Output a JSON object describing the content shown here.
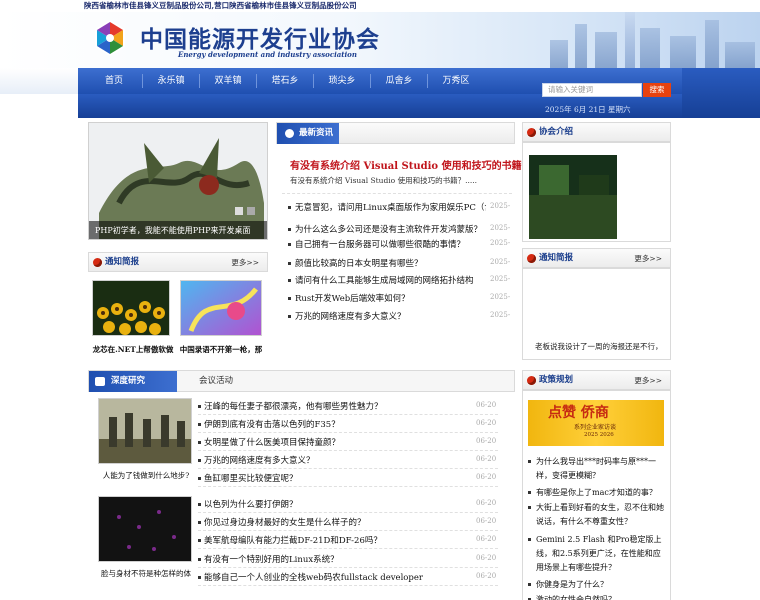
{
  "topbar": {
    "text": "陕西省榆林市佳县锋义豆制品股份公司,营口陕西省榆林市佳县锋义豆制品股份公司"
  },
  "header": {
    "title": "中国能源开发行业协会",
    "subtitle": "Energy development and industry association"
  },
  "nav": {
    "items": [
      "首页",
      "永乐镇",
      "双羊镇",
      "塔石乡",
      "琐尖乡",
      "瓜舍乡",
      "万秀区"
    ]
  },
  "search": {
    "placeholder": "请输入关键词",
    "button": "搜索"
  },
  "date": "2025年 6月 21日  星期六",
  "slide": {
    "caption": "PHP初学者，我能不能使用PHP来开发桌面"
  },
  "latest": {
    "title": "最新资讯",
    "headline": "有没有系统介绍 Visual Studio 使用和技巧的书籍？",
    "summary": "有没有系统介绍 Visual Studio 使用和技巧的书籍？.....",
    "items": [
      {
        "text": "无意冒犯，请问用Linux桌面版作为家用娱乐PC（含",
        "date": "2025-"
      },
      {
        "text": "为什么这么多公司还是没有主流软件开发鸿蒙版？",
        "date": "2025-"
      },
      {
        "text": "自己拥有一台服务器可以做哪些很酷的事情？",
        "date": "2025-"
      },
      {
        "text": "颜值比较高的日本女明星有哪些？",
        "date": "2025-"
      },
      {
        "text": "请问有什么工具能够生成局域网的网络拓扑结构",
        "date": "2025-"
      },
      {
        "text": "Rust开发Web后端效率如何？",
        "date": "2025-"
      },
      {
        "text": "万兆的网络速度有多大意义？",
        "date": "2025-"
      }
    ]
  },
  "notice": {
    "title": "通知简报",
    "more": "更多>>",
    "items": [
      {
        "caption": "龙芯在.NET上帮傲软做"
      },
      {
        "caption": "中国录语不开第一枪，那"
      }
    ]
  },
  "association": {
    "title": "协会介绍"
  },
  "notice_right": {
    "title": "通知简报",
    "more": "更多>>",
    "caption": "老板说我设计了一周的海报还是不行，"
  },
  "research": {
    "tab_active": "深度研究",
    "tab_other": "会议活动",
    "groups": [
      {
        "caption": "人能为了钱做到什么地步?",
        "items": [
          {
            "text": "汪峰的每任妻子都很漂亮，他有哪些男性魅力？",
            "date": "06-20"
          },
          {
            "text": "伊朗到底有没有击落以色列的F35？",
            "date": "06-20"
          },
          {
            "text": "女明星做了什么医美项目保持童颜？",
            "date": "06-20"
          },
          {
            "text": "万兆的网络速度有多大意义？",
            "date": "06-20"
          },
          {
            "text": "鱼缸哪里买比较便宜呢？",
            "date": "06-20"
          }
        ]
      },
      {
        "caption": "脸与身材不符是种怎样的体",
        "items": [
          {
            "text": "以色列为什么要打伊朗？",
            "date": "06-20"
          },
          {
            "text": "你见过身边身材最好的女生是什么样子的？",
            "date": "06-20"
          },
          {
            "text": "美军航母编队有能力拦截DF-21D和DF-26吗？",
            "date": "06-20"
          },
          {
            "text": "有没有一个特别好用的Linux系统？",
            "date": "06-20"
          },
          {
            "text": "能够自己一个人创业的全栈web码农fullstack developer",
            "date": "06-20"
          }
        ]
      }
    ]
  },
  "policy": {
    "title": "政策规划",
    "more": "更多>>",
    "banner": {
      "big": "点赞  侨商",
      "small": "系列企业家访谈",
      "tiny": "2025 2026"
    },
    "items": [
      "为什么我导出***时码率与原***一样，变得更模糊？",
      "有哪些是你上了mac才知道的事？",
      "大街上看到好看的女生，忍不住和她说话，有什么不尊重女性？",
      "Gemini 2.5 Flash 和Pro稳定版上线，和2.5系列更广泛，在性能和应用场景上有哪些提升？",
      "你健身是为了什么？",
      "激动的女性会自然吗？"
    ]
  },
  "colors": {
    "primary": "#1f4fb0",
    "accent": "#d52a12",
    "search_button": "#e8420f"
  }
}
